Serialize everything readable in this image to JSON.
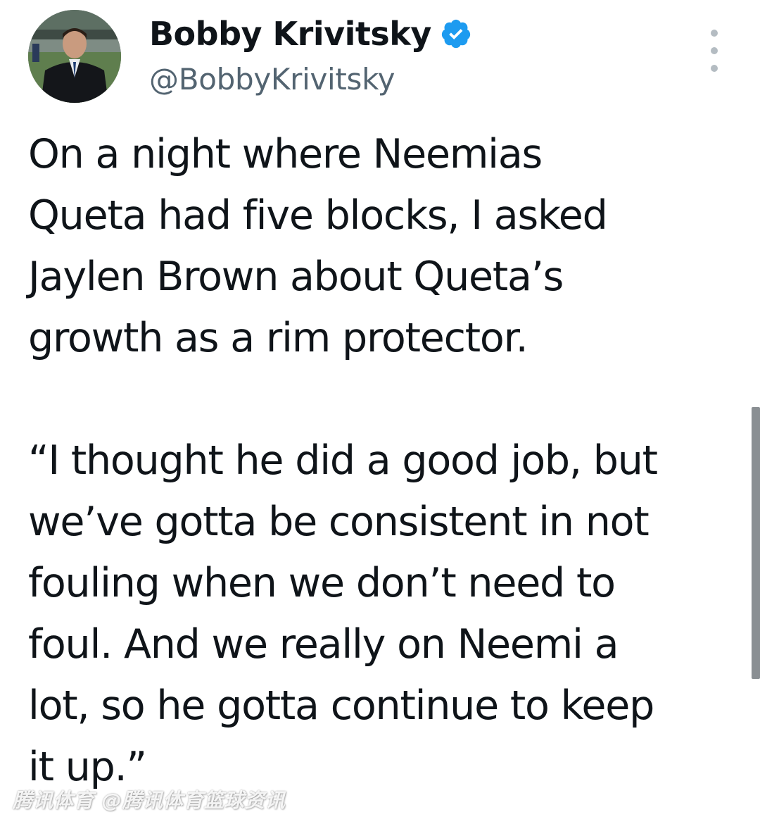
{
  "author": {
    "display_name": "Bobby Krivitsky",
    "handle": "@BobbyKrivitsky",
    "verified": true,
    "avatar_icon": "profile-photo",
    "verified_icon": "verified-badge-icon",
    "verified_color": "#1d9bf0"
  },
  "tweet": {
    "paragraph_1": "On a night where Neemias\nQueta had five blocks, I asked\nJaylen Brown about Queta’s\ngrowth as a rim protector.",
    "paragraph_2": "“I thought he did a good job, but\nwe’ve gotta be consistent in not\nfouling when we don’t need to\nfoul. And we really on Neemi a\nlot, so he gotta continue to keep\nit up.”"
  },
  "watermark": {
    "text": "腾讯体育 @腾讯体育篮球资讯"
  },
  "more_icon": "more-options-icon"
}
